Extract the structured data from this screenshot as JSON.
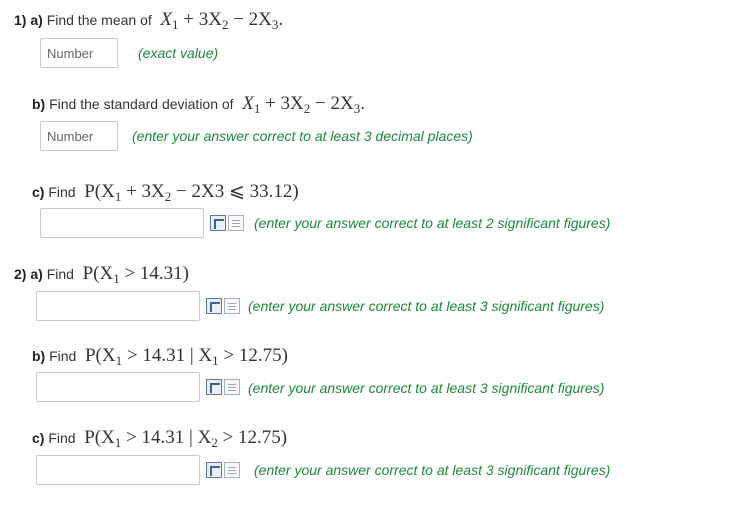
{
  "q1": {
    "a": {
      "prefix": "1) a)",
      "text": "Find the mean of",
      "math": [
        "X",
        "1",
        " + 3X",
        "2",
        " − 2X",
        "3",
        "."
      ],
      "placeholder": "Number",
      "hint": "(exact value)"
    },
    "b": {
      "prefix": "b)",
      "text": "Find the standard deviation of",
      "math": [
        "X",
        "1",
        " + 3X",
        "2",
        " − 2X",
        "3",
        "."
      ],
      "placeholder": "Number",
      "hint": "(enter your answer correct to at least 3 decimal places)"
    },
    "c": {
      "prefix": "c)",
      "text": "Find",
      "math_pre": "P(X",
      "sub1": "1",
      "math_mid": " + 3X",
      "sub2": "2",
      "math_post": " − 2X3 ⩽ 33.12)",
      "hint": "(enter your answer correct to at least 2 significant figures)"
    }
  },
  "q2": {
    "a": {
      "prefix": "2) a)",
      "text": "Find",
      "math_pre": "P(X",
      "sub1": "1",
      "math_post": " > 14.31)",
      "hint": "(enter your answer correct to at least 3 significant figures)"
    },
    "b": {
      "prefix": "b)",
      "text": "Find",
      "math_pre": "P(X",
      "sub1": "1",
      "math_mid": " > 14.31 | X",
      "sub2": "1",
      "math_post": " > 12.75)",
      "hint": "(enter your answer correct to at least 3 significant figures)"
    },
    "c": {
      "prefix": "c)",
      "text": "Find",
      "math_pre": "P(X",
      "sub1": "1",
      "math_mid": " > 14.31 | X",
      "sub2": "2",
      "math_post": " > 12.75)",
      "hint": "(enter your answer correct to at least 3 significant figures)"
    }
  },
  "icons": {
    "preview": "preview-icon",
    "help": "help-icon"
  },
  "colors": {
    "hint": "#1a8a3a",
    "text": "#333333",
    "border": "#c9c9c9"
  }
}
